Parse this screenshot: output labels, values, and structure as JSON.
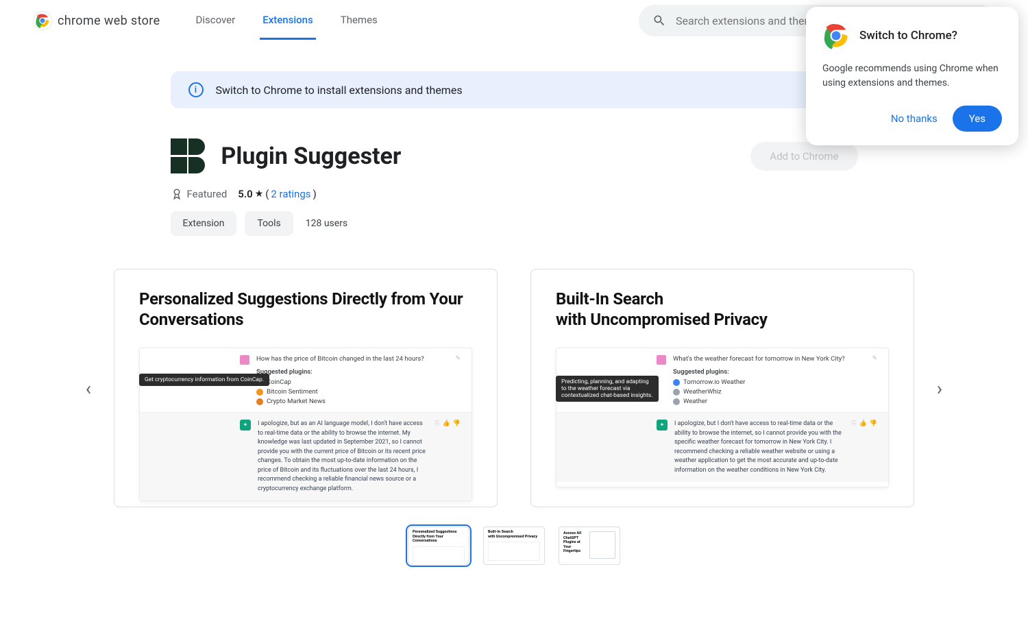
{
  "header": {
    "store_name": "chrome web store",
    "nav": {
      "discover": "Discover",
      "extensions": "Extensions",
      "themes": "Themes"
    },
    "search_placeholder": "Search extensions and themes"
  },
  "banner": {
    "text": "Switch to Chrome to install extensions and themes"
  },
  "extension": {
    "title": "Plugin Suggester",
    "add_button": "Add to Chrome",
    "featured": "Featured",
    "rating": "5.0",
    "ratings_count": "2 ratings",
    "chip_extension": "Extension",
    "chip_tools": "Tools",
    "users": "128 users"
  },
  "slides": [
    {
      "title": "Personalized Suggestions Directly from Your Conversations",
      "question": "How has the price of Bitcoin changed in the last 24 hours?",
      "suggested_label": "Suggested plugins:",
      "plugins": [
        {
          "name": "CoinCap",
          "color": "#2aa8e0"
        },
        {
          "name": "Bitcoin Sentiment",
          "color": "#f7931a"
        },
        {
          "name": "Crypto Market News",
          "color": "#e67e22"
        }
      ],
      "tooltip": "Get cryptocurrency information from CoinCap.",
      "reply": "I apologize, but as an AI language model, I don't have access to real-time data or the ability to browse the internet. My knowledge was last updated in September 2021, so I cannot provide you with the current price of Bitcoin or its recent price changes. To obtain the most up-to-date information on the price of Bitcoin and its fluctuations over the last 24 hours, I recommend checking a reliable financial news source or a cryptocurrency exchange platform."
    },
    {
      "title": "Built-In Search\nwith Uncompromised Privacy",
      "question": "What's the weather forecast for tomorrow in New York City?",
      "suggested_label": "Suggested plugins:",
      "plugins": [
        {
          "name": "Tomorrow.io Weather",
          "color": "#3b82f6"
        },
        {
          "name": "WeatherWhiz",
          "color": "#6b7280"
        },
        {
          "name": "Weather",
          "color": "#6b7280"
        }
      ],
      "tooltip": "Predicting, planning, and adapting to the weather forecast via contextualized chat-based insights.",
      "reply": "I apologize, but I don't have access to real-time data or the ability to browse the internet, so I cannot provide you with the specific weather forecast for tomorrow in New York City. I recommend checking a reliable weather website or using a weather application to get the most accurate and up-to-date information on the weather conditions in New York City."
    }
  ],
  "thumbs": [
    {
      "title": "Personalized Suggestions Directly from Your Conversations"
    },
    {
      "title": "Built-In Search\nwith Uncompromised Privacy"
    },
    {
      "title": "Access All ChatGPT Plugins at Your Fingertips"
    }
  ],
  "dialog": {
    "title": "Switch to Chrome?",
    "body": "Google recommends using Chrome when using extensions and themes.",
    "no": "No thanks",
    "yes": "Yes"
  }
}
